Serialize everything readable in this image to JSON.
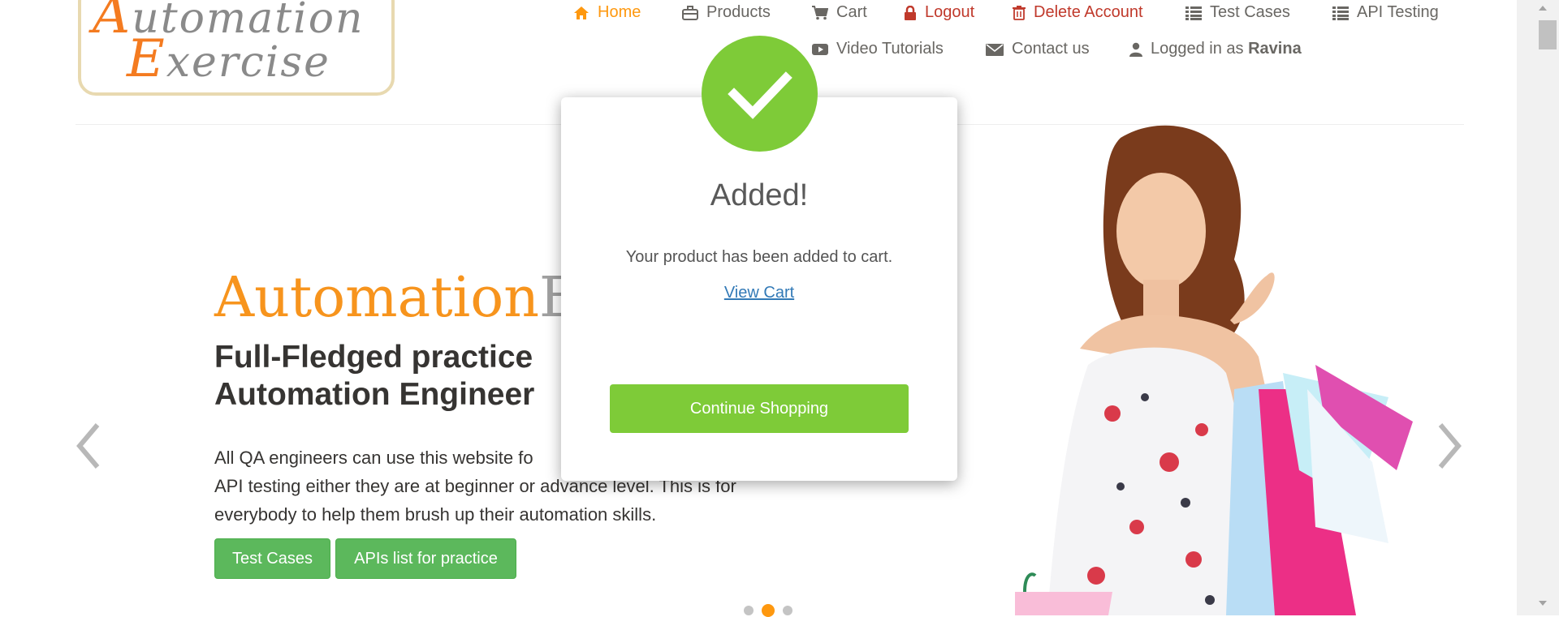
{
  "logo": {
    "line1_cap": "A",
    "line1_rest": "utomation",
    "line2_cap": "E",
    "line2_rest": "xercise"
  },
  "nav": {
    "home": "Home",
    "products": "Products",
    "cart": "Cart",
    "logout": "Logout",
    "delete_account": "Delete Account",
    "test_cases": "Test Cases",
    "api_testing": "API Testing",
    "video_tutorials": "Video Tutorials",
    "contact_us": "Contact us",
    "logged_in_prefix": "Logged in as",
    "logged_in_user": "Ravina"
  },
  "hero": {
    "title_part1": "Automation",
    "title_part2": "Ex",
    "subtitle_line1": "Full-Fledged practice",
    "subtitle_line2": "Automation Engineer",
    "desc_line1": "All QA engineers can use this website fo",
    "desc_line2": "API testing either they are at beginner or advance level. This is for",
    "desc_line3": "everybody to help them brush up their automation skills.",
    "btn_test_cases": "Test Cases",
    "btn_apis": "APIs list for practice"
  },
  "carousel": {
    "active_index": 1,
    "count": 3
  },
  "modal": {
    "title": "Added!",
    "message": "Your product has been added to cart.",
    "view_cart": "View Cart",
    "continue": "Continue Shopping"
  },
  "colors": {
    "accent": "#fe980f",
    "success": "#7ecb38",
    "button_green": "#5cb85c",
    "danger": "#c0392b"
  }
}
